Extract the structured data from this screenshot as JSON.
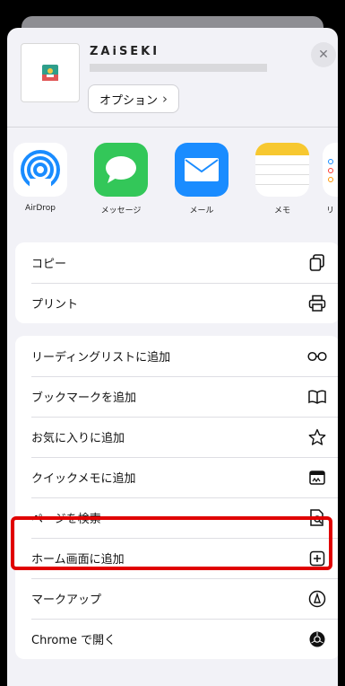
{
  "header": {
    "app_title": "ZAiSEKI",
    "options_label": "オプション",
    "options_chevron": "›",
    "close_symbol": "✕"
  },
  "share_targets": [
    {
      "label": "AirDrop",
      "icon": "airdrop-icon"
    },
    {
      "label": "メッセージ",
      "icon": "messages-icon"
    },
    {
      "label": "メール",
      "icon": "mail-icon"
    },
    {
      "label": "メモ",
      "icon": "notes-icon"
    },
    {
      "label": "リ",
      "icon": "reminders-icon"
    }
  ],
  "group1": [
    {
      "label": "コピー",
      "icon": "copy-icon"
    },
    {
      "label": "プリント",
      "icon": "printer-icon"
    }
  ],
  "group2": [
    {
      "label": "リーディングリストに追加",
      "icon": "glasses-icon"
    },
    {
      "label": "ブックマークを追加",
      "icon": "book-icon"
    },
    {
      "label": "お気に入りに追加",
      "icon": "star-icon"
    },
    {
      "label": "クイックメモに追加",
      "icon": "quick-note-icon"
    },
    {
      "label": "ページを検索",
      "icon": "find-in-page-icon"
    },
    {
      "label": "ホーム画面に追加",
      "icon": "add-square-icon"
    },
    {
      "label": "マークアップ",
      "icon": "markup-icon"
    },
    {
      "label": "Chrome で開く",
      "icon": "chrome-icon"
    }
  ],
  "highlight_color": "#e00000"
}
